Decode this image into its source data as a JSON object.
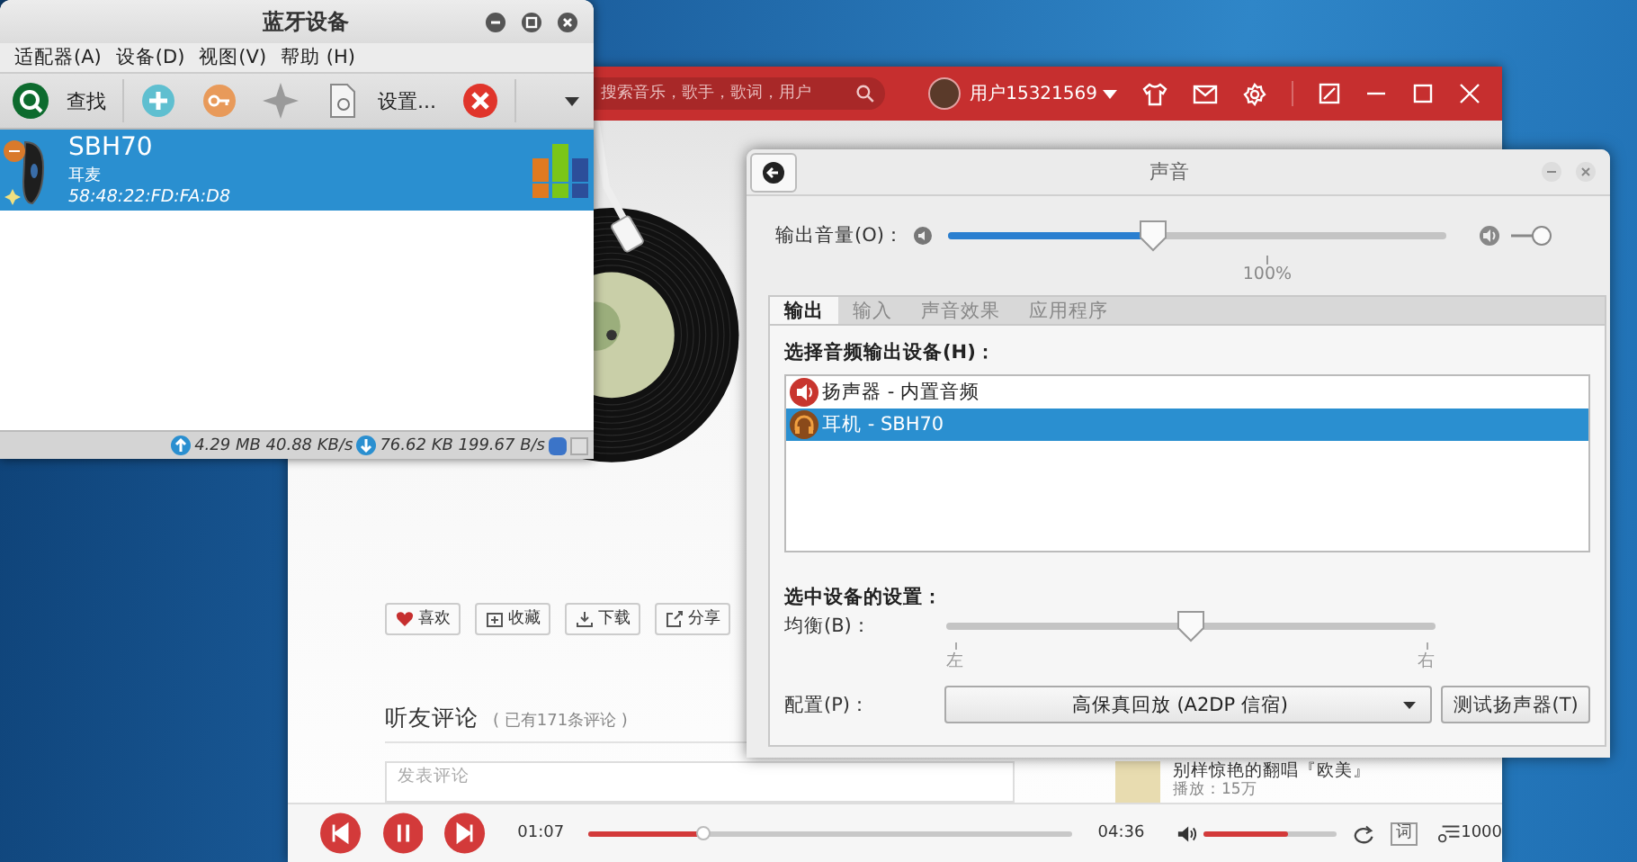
{
  "music_player": {
    "search": {
      "placeholder": "搜索音乐，歌手，歌词，用户"
    },
    "user": "用户15321569",
    "actions": [
      {
        "kind": "heart",
        "label": "喜欢"
      },
      {
        "kind": "collect",
        "label": "收藏"
      },
      {
        "kind": "download",
        "label": "下载"
      },
      {
        "kind": "share",
        "label": "分享"
      }
    ],
    "comments": {
      "title": "听友评论",
      "count": "( 已有171条评论 )",
      "placeholder": "发表评论"
    },
    "recommendation": {
      "title": "别样惊艳的翻唱『欧美』",
      "plays": "播放：15万"
    },
    "player": {
      "elapsed": "01:07",
      "total": "04:36",
      "progress": {
        "level": 0.24
      },
      "volume": {
        "level": 0.63
      },
      "lyrics": "词",
      "playlist_count": "1000"
    }
  },
  "bluetooth_window": {
    "title": "蓝牙设备",
    "menu": [
      "适配器(A)",
      "设备(D)",
      "视图(V)",
      "帮助 (H)"
    ],
    "toolbar": [
      {
        "kind": "search",
        "label": "查找"
      },
      {
        "kind": "add"
      },
      {
        "kind": "key"
      },
      {
        "kind": "star"
      },
      {
        "kind": "settings",
        "label": "设置..."
      },
      {
        "kind": "remove"
      }
    ],
    "devices": [
      {
        "name": "SBH70",
        "type": "耳麦",
        "address": "58:48:22:FD:FA:D8",
        "selected": true
      }
    ],
    "status": {
      "upload": "4.29 MB 40.88 KB/s",
      "download": "76.62 KB 199.67 B/s"
    }
  },
  "sound_window": {
    "title": "声音",
    "volume": {
      "label": "输出音量(O)：",
      "level": 0.41,
      "mark": "100%"
    },
    "tabs": [
      {
        "label": "输出",
        "selected": true
      },
      {
        "label": "输入",
        "selected": false
      },
      {
        "label": "声音效果",
        "selected": false
      },
      {
        "label": "应用程序",
        "selected": false
      }
    ],
    "device_heading": "选择音频输出设备(H)：",
    "output_devices": [
      {
        "kind": "speaker",
        "label": "扬声器 - 内置音频",
        "selected": false
      },
      {
        "kind": "headphones",
        "label": "耳机 - SBH70",
        "selected": true
      }
    ],
    "settings_heading": "选中设备的设置：",
    "balance": {
      "label": "均衡(B)：",
      "level": 0.5,
      "left": "左",
      "right": "右"
    },
    "profile": {
      "label": "配置(P)：",
      "value": "高保真回放 (A2DP 信宿)"
    },
    "test_button": "测试扬声器(T)"
  }
}
